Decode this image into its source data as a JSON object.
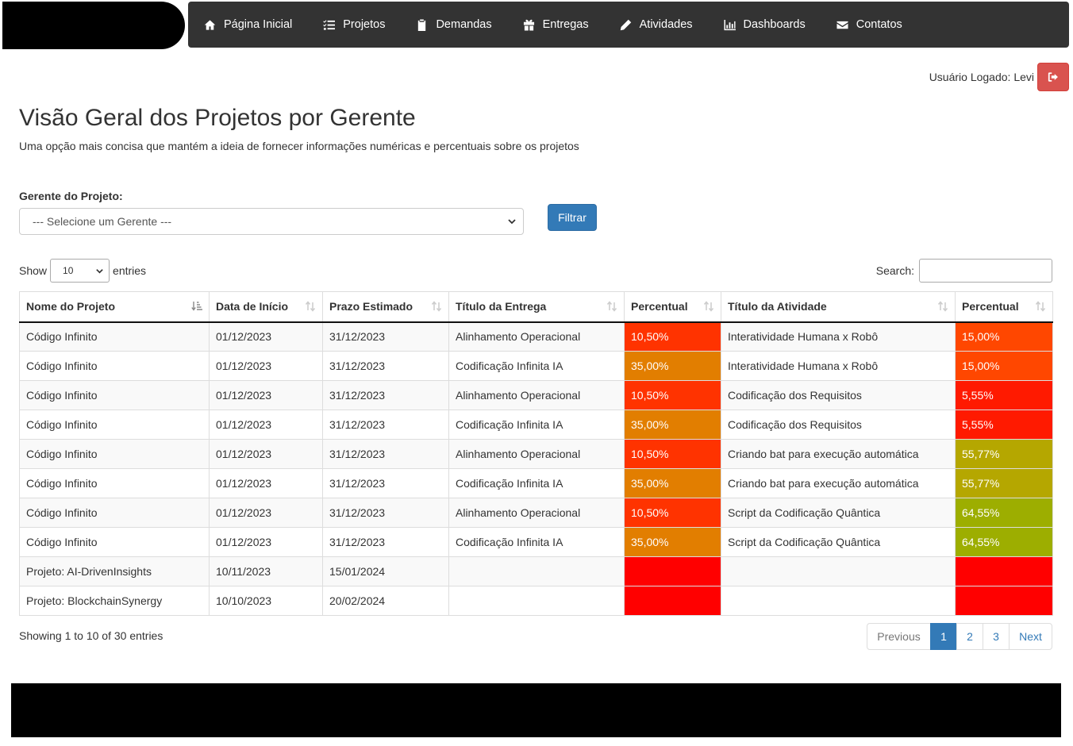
{
  "navbar": {
    "items": [
      {
        "label": "Página Inicial",
        "icon": "home-icon"
      },
      {
        "label": "Projetos",
        "icon": "tasks-icon"
      },
      {
        "label": "Demandas",
        "icon": "clipboard-icon"
      },
      {
        "label": "Entregas",
        "icon": "gift-icon"
      },
      {
        "label": "Atividades",
        "icon": "pencil-icon"
      },
      {
        "label": "Dashboards",
        "icon": "bar-chart-icon"
      },
      {
        "label": "Contatos",
        "icon": "envelope-icon"
      }
    ]
  },
  "user": {
    "label": "Usuário Logado: Levi",
    "logout_icon": "logout-icon",
    "logout_color": "#d9534f"
  },
  "page": {
    "title": "Visão Geral dos Projetos por Gerente",
    "subtitle": "Uma opção mais concisa que mantém a ideia de fornecer informações numéricas e percentuais sobre os projetos"
  },
  "filter": {
    "label": "Gerente do Projeto:",
    "selected": "--- Selecione um Gerente ---",
    "button": "Filtrar",
    "button_color": "#337ab7"
  },
  "datatable": {
    "show_label": "Show",
    "entries_label": "entries",
    "length_value": "10",
    "search_label": "Search:",
    "search_value": "",
    "columns": [
      "Nome do Projeto",
      "Data de Início",
      "Prazo Estimado",
      "Título da Entrega",
      "Percentual",
      "Título da Atividade",
      "Percentual"
    ],
    "rows": [
      {
        "projeto": "Código Infinito",
        "inicio": "01/12/2023",
        "prazo": "31/12/2023",
        "entrega": "Alinhamento Operacional",
        "pct_entrega": "10,50%",
        "pct_entrega_color": "#ff3300",
        "atividade": "Interatividade Humana x Robô",
        "pct_atividade": "15,00%",
        "pct_atividade_color": "#ff4700"
      },
      {
        "projeto": "Código Infinito",
        "inicio": "01/12/2023",
        "prazo": "31/12/2023",
        "entrega": "Codificação Infinita IA",
        "pct_entrega": "35,00%",
        "pct_entrega_color": "#e27e00",
        "atividade": "Interatividade Humana x Robô",
        "pct_atividade": "15,00%",
        "pct_atividade_color": "#ff4700"
      },
      {
        "projeto": "Código Infinito",
        "inicio": "01/12/2023",
        "prazo": "31/12/2023",
        "entrega": "Alinhamento Operacional",
        "pct_entrega": "10,50%",
        "pct_entrega_color": "#ff3300",
        "atividade": "Codificação dos Requisitos",
        "pct_atividade": "5,55%",
        "pct_atividade_color": "#ff1a00"
      },
      {
        "projeto": "Código Infinito",
        "inicio": "01/12/2023",
        "prazo": "31/12/2023",
        "entrega": "Codificação Infinita IA",
        "pct_entrega": "35,00%",
        "pct_entrega_color": "#e27e00",
        "atividade": "Codificação dos Requisitos",
        "pct_atividade": "5,55%",
        "pct_atividade_color": "#ff1a00"
      },
      {
        "projeto": "Código Infinito",
        "inicio": "01/12/2023",
        "prazo": "31/12/2023",
        "entrega": "Alinhamento Operacional",
        "pct_entrega": "10,50%",
        "pct_entrega_color": "#ff3300",
        "atividade": "Criando bat para execução automática",
        "pct_atividade": "55,77%",
        "pct_atividade_color": "#b5a700"
      },
      {
        "projeto": "Código Infinito",
        "inicio": "01/12/2023",
        "prazo": "31/12/2023",
        "entrega": "Codificação Infinita IA",
        "pct_entrega": "35,00%",
        "pct_entrega_color": "#e27e00",
        "atividade": "Criando bat para execução automática",
        "pct_atividade": "55,77%",
        "pct_atividade_color": "#b5a700"
      },
      {
        "projeto": "Código Infinito",
        "inicio": "01/12/2023",
        "prazo": "31/12/2023",
        "entrega": "Alinhamento Operacional",
        "pct_entrega": "10,50%",
        "pct_entrega_color": "#ff3300",
        "atividade": "Script da Codificação Quântica",
        "pct_atividade": "64,55%",
        "pct_atividade_color": "#9dae00"
      },
      {
        "projeto": "Código Infinito",
        "inicio": "01/12/2023",
        "prazo": "31/12/2023",
        "entrega": "Codificação Infinita IA",
        "pct_entrega": "35,00%",
        "pct_entrega_color": "#e27e00",
        "atividade": "Script da Codificação Quântica",
        "pct_atividade": "64,55%",
        "pct_atividade_color": "#9dae00"
      },
      {
        "projeto": "Projeto: AI-DrivenInsights",
        "inicio": "10/11/2023",
        "prazo": "15/01/2024",
        "entrega": "",
        "pct_entrega": "",
        "pct_entrega_color": "#ff0000",
        "atividade": "",
        "pct_atividade": "",
        "pct_atividade_color": "#ff0000"
      },
      {
        "projeto": "Projeto: BlockchainSynergy",
        "inicio": "10/10/2023",
        "prazo": "20/02/2024",
        "entrega": "",
        "pct_entrega": "",
        "pct_entrega_color": "#ff0000",
        "atividade": "",
        "pct_atividade": "",
        "pct_atividade_color": "#ff0000"
      }
    ],
    "info": "Showing 1 to 10 of 30 entries",
    "pagination": {
      "previous": "Previous",
      "pages": [
        "1",
        "2",
        "3"
      ],
      "active": "1",
      "next": "Next"
    }
  }
}
